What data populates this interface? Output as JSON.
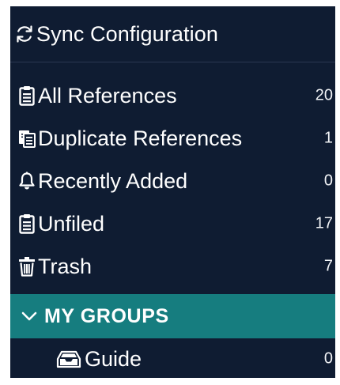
{
  "sync": {
    "label": "Sync Configuration",
    "icon": "sync-icon"
  },
  "library": {
    "items": [
      {
        "label": "All References",
        "count": "20",
        "icon": "clipboard-icon"
      },
      {
        "label": "Duplicate References",
        "count": "1",
        "icon": "duplicate-clipboard-icon"
      },
      {
        "label": "Recently Added",
        "count": "0",
        "icon": "bell-icon"
      },
      {
        "label": "Unfiled",
        "count": "17",
        "icon": "clipboard-icon"
      },
      {
        "label": "Trash",
        "count": "7",
        "icon": "trash-icon"
      }
    ]
  },
  "groups": {
    "header": "MY GROUPS",
    "items": [
      {
        "label": "Guide",
        "count": "0",
        "icon": "inbox-tray-icon"
      }
    ]
  },
  "colors": {
    "panel_background": "#0f1c32",
    "group_header_background": "#167d7f",
    "text": "#ffffff"
  }
}
